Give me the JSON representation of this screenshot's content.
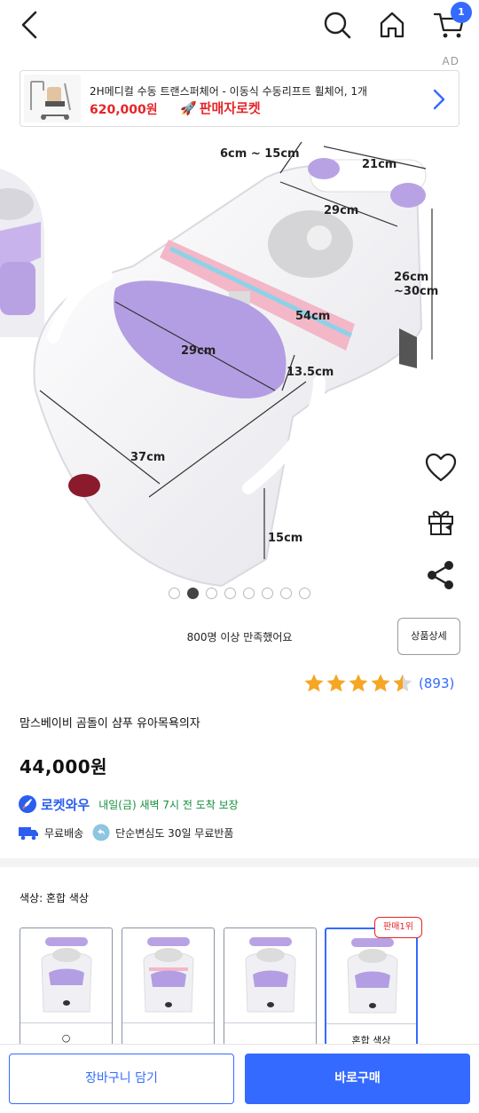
{
  "header": {
    "back_icon": "chevron-left-icon",
    "search_icon": "search-icon",
    "home_icon": "home-icon",
    "cart_icon": "cart-icon",
    "cart_badge": "1"
  },
  "ad": {
    "label": "AD",
    "title": "2H메디컬 수동 트랜스퍼체어 - 이동식 수동리프트 휠체어, 1개",
    "price": "620,000원",
    "seller_badge": "판매자로켓",
    "arrow_icon": "chevron-right-icon"
  },
  "gallery": {
    "dimensions": {
      "d1": "6cm ~ 15cm",
      "d2": "21cm",
      "d3": "29cm",
      "d4": "26cm",
      "d5": "~30cm",
      "d6": "54cm",
      "d7": "29cm",
      "d8": "13.5cm",
      "d9": "37cm",
      "d10": "15cm"
    },
    "dot_count": 8,
    "active_dot": 1
  },
  "side_actions": {
    "wishlist_icon": "heart-icon",
    "gift_icon": "gift-icon",
    "share_icon": "share-icon"
  },
  "satisfaction": "800명 이상 만족했어요",
  "detail_button": "상품상세",
  "rating": {
    "stars": 4.5,
    "review_count": "(893)"
  },
  "product": {
    "title": "맘스베이비 곰돌이 샴푸 유아목욕의자",
    "price": "44,000원"
  },
  "delivery": {
    "rocket_label": "로켓와우",
    "arrival_note": "내일(금) 새벽 7시 전 도착 보장",
    "free_shipping": "무료배송",
    "return_note": "단순변심도 30일 무료반품"
  },
  "options": {
    "label": "색상: 혼합 색상",
    "items": [
      {
        "label": "○"
      },
      {
        "label": ""
      },
      {
        "label": ""
      },
      {
        "label": "혼합 색상"
      }
    ],
    "best_badge": "판매1위"
  },
  "bottom": {
    "cart_button": "장바구니 담기",
    "buy_button": "바로구매"
  },
  "colors": {
    "accent": "#346aff",
    "sale_red": "#e52528",
    "delivery_green": "#168e3c",
    "purple": "#b9a6e2"
  }
}
